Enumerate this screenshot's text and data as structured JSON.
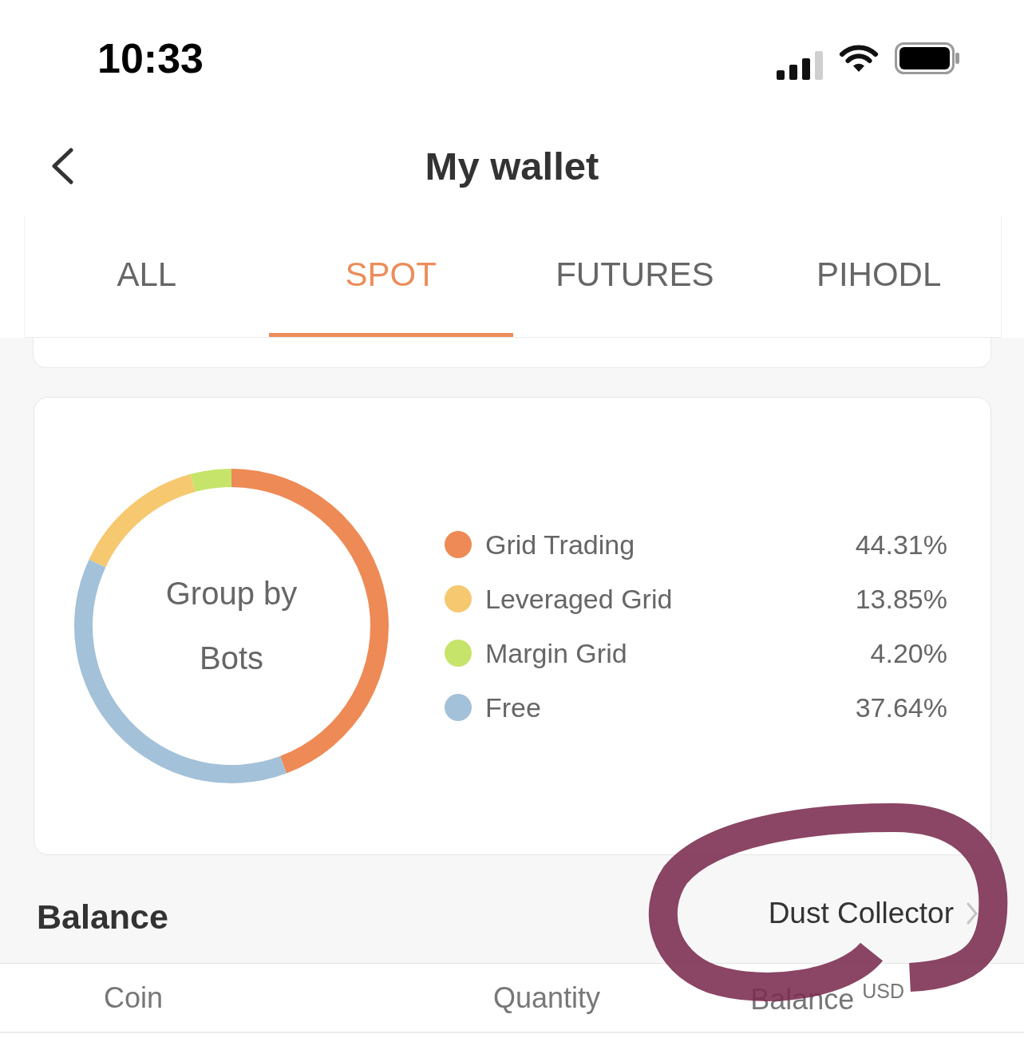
{
  "status_bar": {
    "time": "10:33"
  },
  "header": {
    "title": "My wallet"
  },
  "tabs": [
    {
      "label": "ALL",
      "selected": false
    },
    {
      "label": "SPOT",
      "selected": true
    },
    {
      "label": "FUTURES",
      "selected": false
    },
    {
      "label": "PIHODL",
      "selected": false
    }
  ],
  "allocation_card": {
    "center_label": "Group by Bots",
    "chart_data": {
      "type": "donut",
      "categories": [
        "Grid Trading",
        "Leveraged Grid",
        "Margin Grid",
        "Free"
      ],
      "values": [
        44.31,
        13.85,
        4.2,
        37.64
      ]
    },
    "legend": [
      {
        "value": "44.31%",
        "color": "#ee8a55"
      },
      {
        "value": "13.85%",
        "color": "#f6c870"
      },
      {
        "value": "4.20%",
        "color": "#c6e46a"
      },
      {
        "value": "37.64%",
        "color": "#a3c1d8"
      }
    ]
  },
  "balance_section": {
    "title": "Balance",
    "link": "Dust Collector"
  },
  "table": {
    "columns": [
      "Coin",
      "Quantity",
      "Balance $^{USD}$"
    ]
  }
}
